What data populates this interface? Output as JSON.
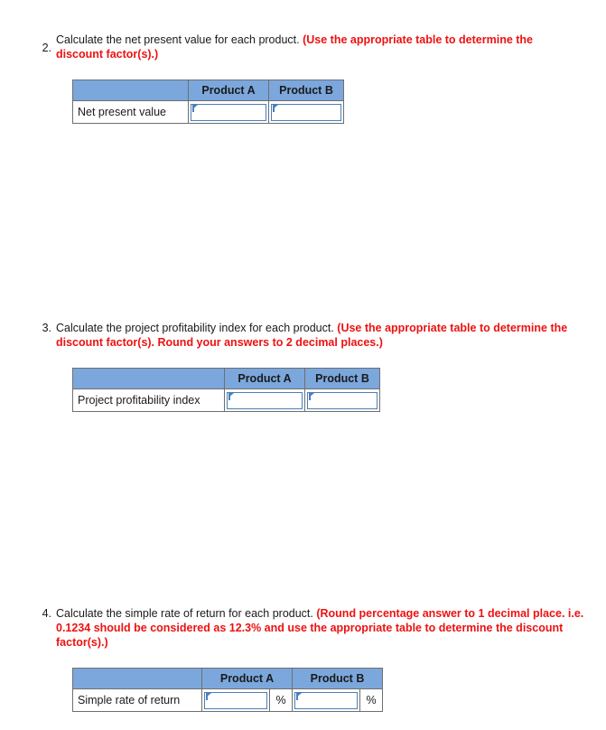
{
  "page": {
    "accent_header_blue": "#7ba7dc",
    "field_border_blue": "#4a7ebb",
    "note_red": "#ee1111",
    "text_color": "#1a1a1a"
  },
  "questions": [
    {
      "number": "2.",
      "prompt": "Calculate the net present value for each product. ",
      "note": "(Use the appropriate table to determine the discount factor(s).)"
    },
    {
      "number": "3.",
      "prompt": "Calculate the project profitability index for each product. ",
      "note": "(Use the appropriate table to determine the discount factor(s). Round your answers to 2 decimal places.)"
    },
    {
      "number": "4.",
      "prompt": "Calculate the simple rate of return for each product. ",
      "note": "(Round percentage answer to 1 decimal place. i.e. 0.1234 should be considered as 12.3% and use the appropriate table to determine the discount factor(s).)"
    }
  ],
  "tables": [
    {
      "corner_header": "",
      "column_headers": [
        "Product A",
        "Product B"
      ],
      "row_label": "Net present value",
      "values": [
        "",
        ""
      ],
      "suffix": ""
    },
    {
      "corner_header": "",
      "column_headers": [
        "Product A",
        "Product B"
      ],
      "row_label": "Project profitability index",
      "values": [
        "",
        ""
      ],
      "suffix": ""
    },
    {
      "corner_header": "",
      "column_headers": [
        "Product A",
        "Product B"
      ],
      "row_label": "Simple rate of return",
      "values": [
        "",
        ""
      ],
      "suffix": "%"
    }
  ]
}
